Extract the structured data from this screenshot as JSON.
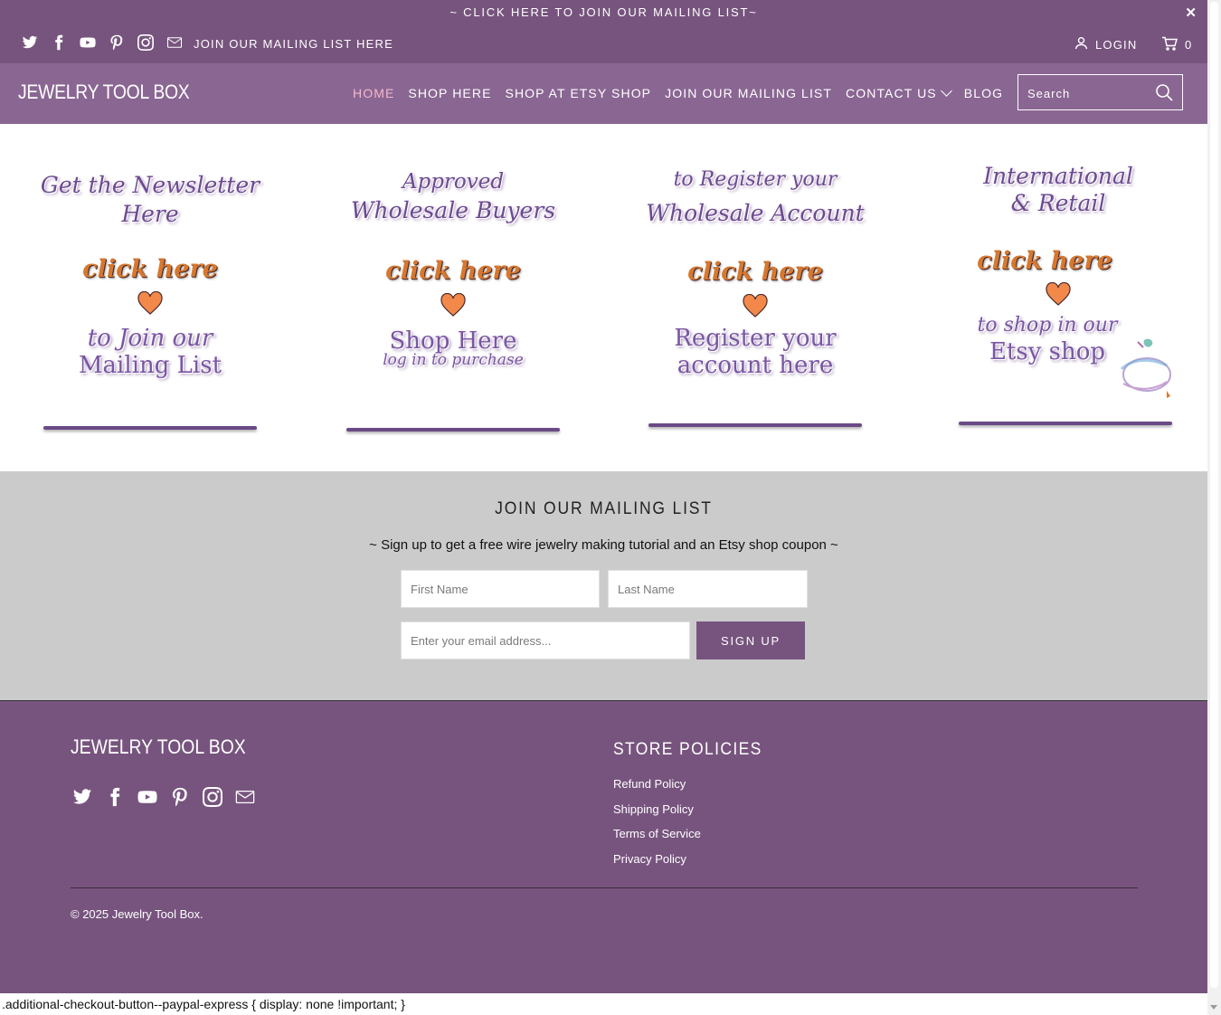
{
  "topbar": {
    "promo": "~ CLICK HERE TO JOIN OUR MAILING LIST~",
    "close": "✕",
    "social_icons": [
      "twitter-icon",
      "facebook-icon",
      "youtube-icon",
      "pinterest-icon",
      "instagram-icon",
      "mail-icon"
    ],
    "mailing_link": "JOIN OUR MAILING LIST HERE",
    "login": "LOGIN",
    "cart_count": "0"
  },
  "header": {
    "logo": "JEWELRY TOOL BOX",
    "nav": [
      "HOME",
      "SHOP HERE",
      "SHOP AT ETSY SHOP",
      "JOIN OUR MAILING LIST",
      "CONTACT US",
      "BLOG"
    ],
    "search_placeholder": "Search"
  },
  "banners": [
    {
      "title": "Get the Newsletter Here",
      "click": "click here",
      "sub1": "to Join our",
      "sub2": "Mailing List"
    },
    {
      "title1": "Approved",
      "title2": "Wholesale Buyers",
      "click": "click here",
      "sub1": "Shop Here",
      "sub2": "log in to purchase"
    },
    {
      "title1": "to Register your",
      "title2": "Wholesale Account",
      "click": "click here",
      "sub1": "Register your",
      "sub2": "account here"
    },
    {
      "title1": "International",
      "title2": "& Retail",
      "click": "click here",
      "sub1": "to shop in our",
      "sub2": "Etsy shop"
    }
  ],
  "mailing": {
    "title": "JOIN OUR MAILING LIST",
    "subtitle": "~ Sign up to get a free wire jewelry making tutorial and an Etsy shop coupon ~",
    "first_name_placeholder": "First Name",
    "last_name_placeholder": "Last Name",
    "email_placeholder": "Enter your email address...",
    "signup_label": "SIGN UP"
  },
  "footer": {
    "logo": "JEWELRY TOOL BOX",
    "policies_title": "STORE POLICIES",
    "policies": [
      "Refund Policy",
      "Shipping Policy",
      "Terms of Service",
      "Privacy Policy"
    ],
    "copyright": "© 2025 Jewelry Tool Box."
  },
  "css_leak": ".additional-checkout-button--paypal-express { display: none !important; }",
  "colors": {
    "primary_purple": "#77547e",
    "header_purple": "#8a6693",
    "accent_pink": "#f4b8c7",
    "banner_orange": "#d7782f",
    "mailing_bg": "#cbcbcb"
  }
}
